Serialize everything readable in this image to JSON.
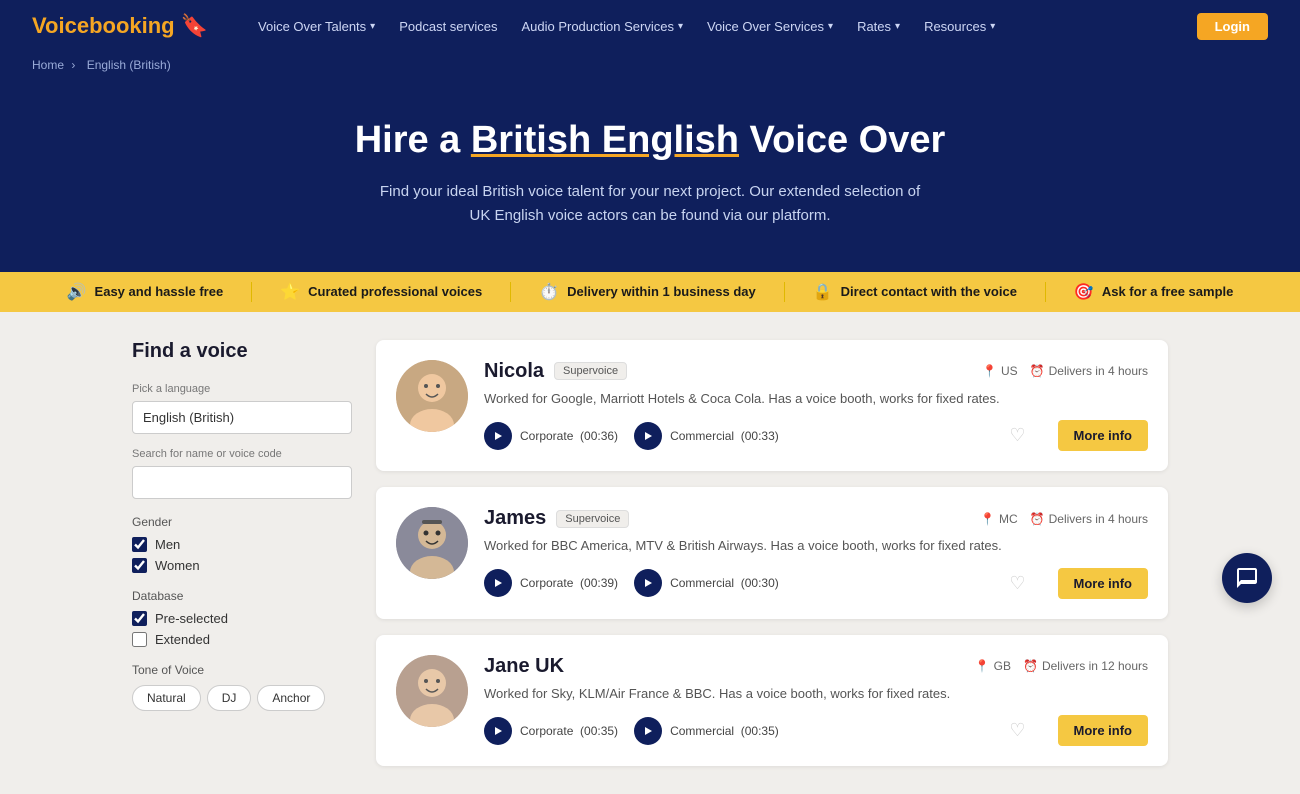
{
  "nav": {
    "logo_text": "Voicebooking",
    "logo_emoji": "🎙️",
    "links": [
      {
        "label": "Voice Over Talents",
        "has_dropdown": true
      },
      {
        "label": "Podcast services",
        "has_dropdown": false
      },
      {
        "label": "Audio Production Services",
        "has_dropdown": true
      },
      {
        "label": "Voice Over Services",
        "has_dropdown": true
      },
      {
        "label": "Rates",
        "has_dropdown": true
      },
      {
        "label": "Resources",
        "has_dropdown": true
      }
    ],
    "login_label": "Login"
  },
  "breadcrumb": {
    "home": "Home",
    "separator": "›",
    "current": "English (British)"
  },
  "hero": {
    "title_plain": "Hire a British English Voice Over",
    "subtitle": "Find your ideal British voice talent for your next project. Our extended selection of UK English voice actors can be found via our platform."
  },
  "feature_bar": {
    "items": [
      {
        "icon": "🔊",
        "label": "Easy and hassle free"
      },
      {
        "icon": "⭐",
        "label": "Curated professional voices"
      },
      {
        "icon": "⏱️",
        "label": "Delivery within 1 business day"
      },
      {
        "icon": "🔒",
        "label": "Direct contact with the voice"
      },
      {
        "icon": "🎯",
        "label": "Ask for a free sample"
      }
    ]
  },
  "sidebar": {
    "title": "Find a voice",
    "language_label": "Pick a language",
    "language_value": "English (British)",
    "search_label": "Search for name or voice code",
    "search_placeholder": "",
    "gender_label": "Gender",
    "gender_options": [
      {
        "label": "Men",
        "checked": true
      },
      {
        "label": "Women",
        "checked": true
      }
    ],
    "database_label": "Database",
    "database_options": [
      {
        "label": "Pre-selected",
        "checked": true
      },
      {
        "label": "Extended",
        "checked": false
      }
    ],
    "tone_label": "Tone of Voice",
    "tone_options": [
      "Natural",
      "DJ",
      "Anchor"
    ]
  },
  "voices": [
    {
      "id": "nicola",
      "name": "Nicola",
      "badge": "Supervoice",
      "country": "US",
      "delivery": "Delivers in 4 hours",
      "description": "Worked for Google, Marriott Hotels & Coca Cola. Has a voice booth, works for fixed rates.",
      "audio_clips": [
        {
          "type": "Corporate",
          "duration": "00:36"
        },
        {
          "type": "Commercial",
          "duration": "00:33"
        }
      ],
      "more_info": "More info"
    },
    {
      "id": "james",
      "name": "James",
      "badge": "Supervoice",
      "country": "MC",
      "delivery": "Delivers in 4 hours",
      "description": "Worked for BBC America, MTV & British Airways. Has a voice booth, works for fixed rates.",
      "audio_clips": [
        {
          "type": "Corporate",
          "duration": "00:39"
        },
        {
          "type": "Commercial",
          "duration": "00:30"
        }
      ],
      "more_info": "More info"
    },
    {
      "id": "jane",
      "name": "Jane UK",
      "badge": "",
      "country": "GB",
      "delivery": "Delivers in 12 hours",
      "description": "Worked for Sky, KLM/Air France & BBC. Has a voice booth, works for fixed rates.",
      "audio_clips": [
        {
          "type": "Corporate",
          "duration": "00:35"
        },
        {
          "type": "Commercial",
          "duration": "00:35"
        }
      ],
      "more_info": "More info"
    }
  ]
}
